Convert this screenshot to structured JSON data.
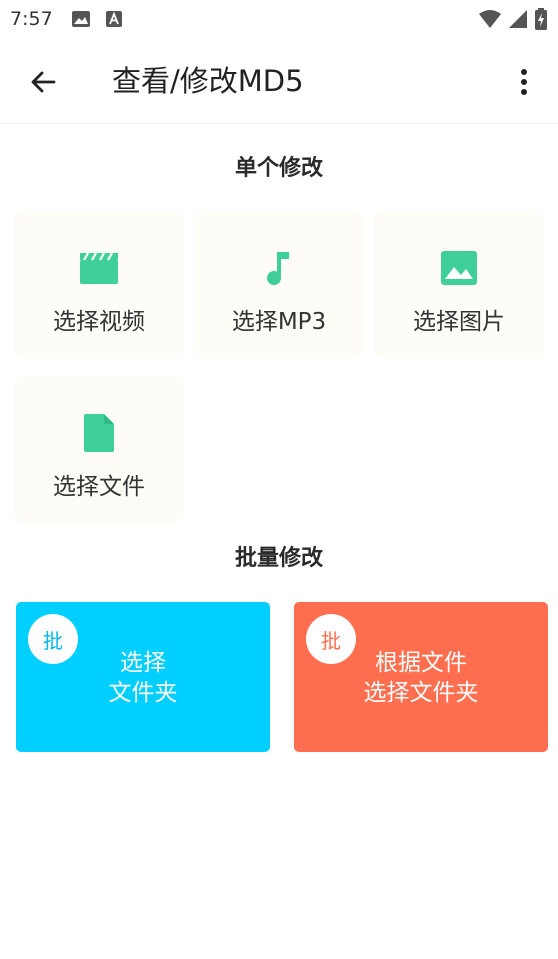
{
  "status_bar": {
    "time": "7:57",
    "icons": [
      "image-icon",
      "text-app-icon",
      "wifi-icon",
      "signal-icon",
      "battery-charging-icon"
    ]
  },
  "app_bar": {
    "back_icon": "arrow-back-icon",
    "title": "查看/修改MD5",
    "menu_icon": "more-vert-icon"
  },
  "single": {
    "section_title": "单个修改",
    "items": [
      {
        "label": "选择视频",
        "icon": "video-clapper-icon"
      },
      {
        "label": "选择MP3",
        "icon": "music-note-icon"
      },
      {
        "label": "选择图片",
        "icon": "image-icon"
      },
      {
        "label": "选择文件",
        "icon": "file-icon"
      }
    ],
    "icon_color": "#3ecf9a"
  },
  "batch": {
    "section_title": "批量修改",
    "cards": [
      {
        "badge": "批",
        "line1": "选择",
        "line2": "文件夹",
        "color": "#00cfff"
      },
      {
        "badge": "批",
        "line1": "根据文件",
        "line2": "选择文件夹",
        "color": "#ff6f4f"
      }
    ]
  }
}
